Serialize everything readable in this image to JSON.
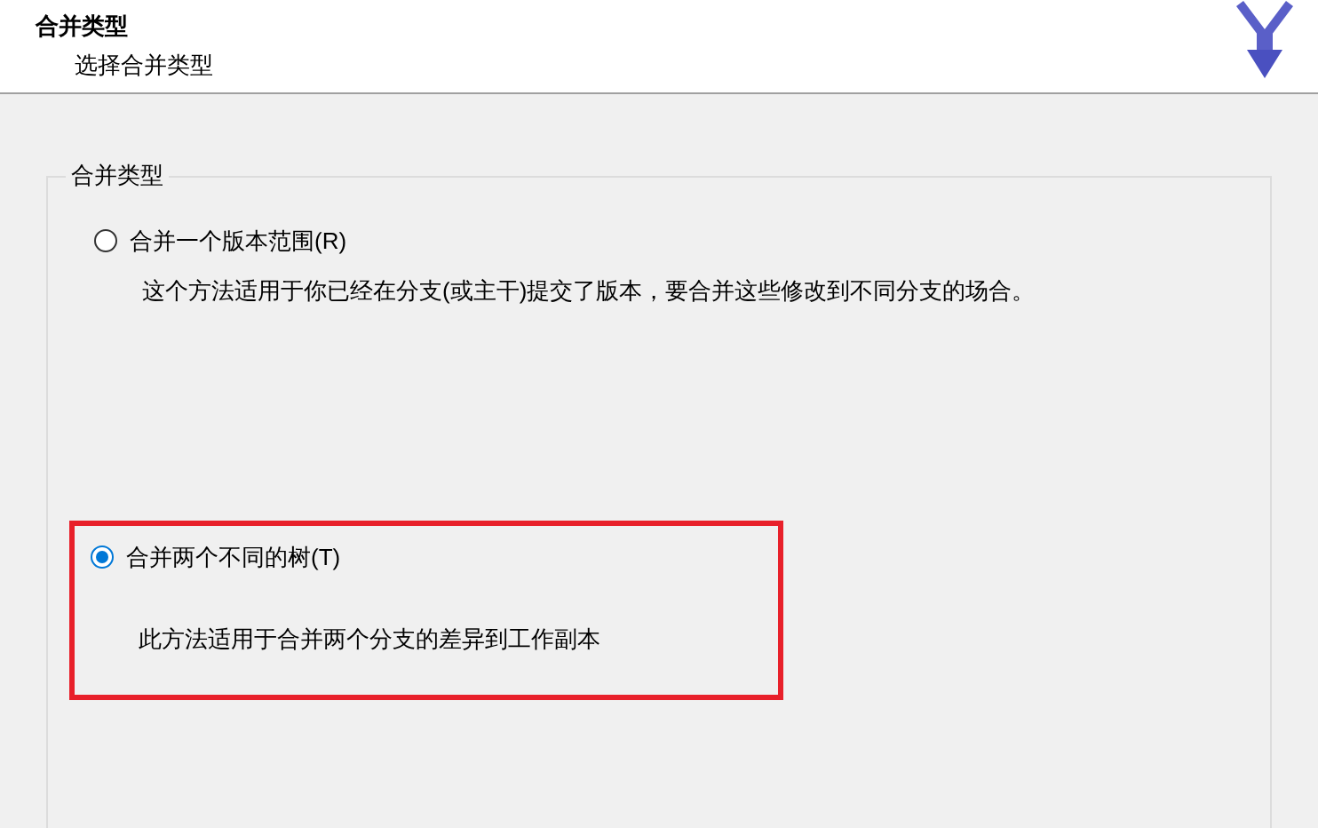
{
  "header": {
    "title": "合并类型",
    "subtitle": "选择合并类型"
  },
  "group": {
    "label": "合并类型",
    "options": [
      {
        "label": "合并一个版本范围(R)",
        "description": "这个方法适用于你已经在分支(或主干)提交了版本，要合并这些修改到不同分支的场合。",
        "selected": false,
        "highlighted": false
      },
      {
        "label": "合并两个不同的树(T)",
        "description": "此方法适用于合并两个分支的差异到工作副本",
        "selected": true,
        "highlighted": true
      }
    ]
  }
}
